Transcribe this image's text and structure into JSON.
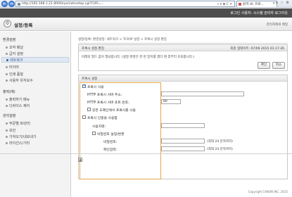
{
  "browser": {
    "back": "←",
    "forward": "→",
    "url": "http://192.168.1.21 8000/rps/nativetop.cgi?CUR=...",
    "url_tools": "⌕ ▾ ⊠ C ✕",
    "tab_title": "원격 UI: 프로...",
    "tab_close": "✕",
    "window_icons": "⌂ ☆ ⚙"
  },
  "header": {
    "info": "로그인 사용자: 시스템 관리자 로그아웃"
  },
  "title_bar": {
    "icon": "⚙",
    "title": "설정/등록",
    "link": "관리자에게 메일"
  },
  "sidebar": {
    "sections": [
      {
        "title": "환경설정",
        "items": [
          "조작 패널",
          "급지 설정",
          "네트워크",
          "타이머",
          "인쇄 품질",
          "사용자 유지보수"
        ]
      },
      {
        "title": "출력(예)",
        "items": [
          "출력하기 메뉴",
          "디바이스 제어"
        ]
      },
      {
        "title": "관리설정",
        "items": [
          "부문별 ID관리",
          "보안",
          "가져오기/내보내기",
          "라이선스/기타"
        ]
      }
    ],
    "active_item": "네트워크"
  },
  "main": {
    "breadcrumb": "설정/등록: 환경설정: 네트워크 > TCP/IP 설정 > 프록시 설정 편집",
    "panel1": {
      "title": "프록시 설정 편집",
      "date": "최종 업데이트: 07/09 2015 01:17:26",
      "message": "아래의 필드 값이 필요합니다. (설정 변경은 한 번 장치를 껐다 켠 후부터 유효합니다.)",
      "ok": "확인",
      "cancel": "취소"
    },
    "panel2": {
      "title": "프록시 설정",
      "use_proxy": "프록시 사용",
      "http_address_label": "HTTP 프록시 서버 주소:",
      "http_address_value": "",
      "http_port_label": "HTTP 프록시 서버 포트 번호:",
      "http_port_value": "80",
      "same_domain": "같은 도메인에서 프록시를 사용",
      "use_auth": "프록시 인증을 사용함",
      "username_label": "사용자명:",
      "username_value": "",
      "set_password": "비밀번호 설정/변경",
      "password_label": "비밀번호:",
      "password_value": "",
      "password_hint": "(최대 24 문자까지)",
      "confirm_label": "확인입력:",
      "confirm_value": "",
      "confirm_hint": "(최대 24 문자까지)"
    }
  },
  "footer": {
    "top_icon": "▲",
    "copyright": "Copyright CANON INC. 2015"
  }
}
